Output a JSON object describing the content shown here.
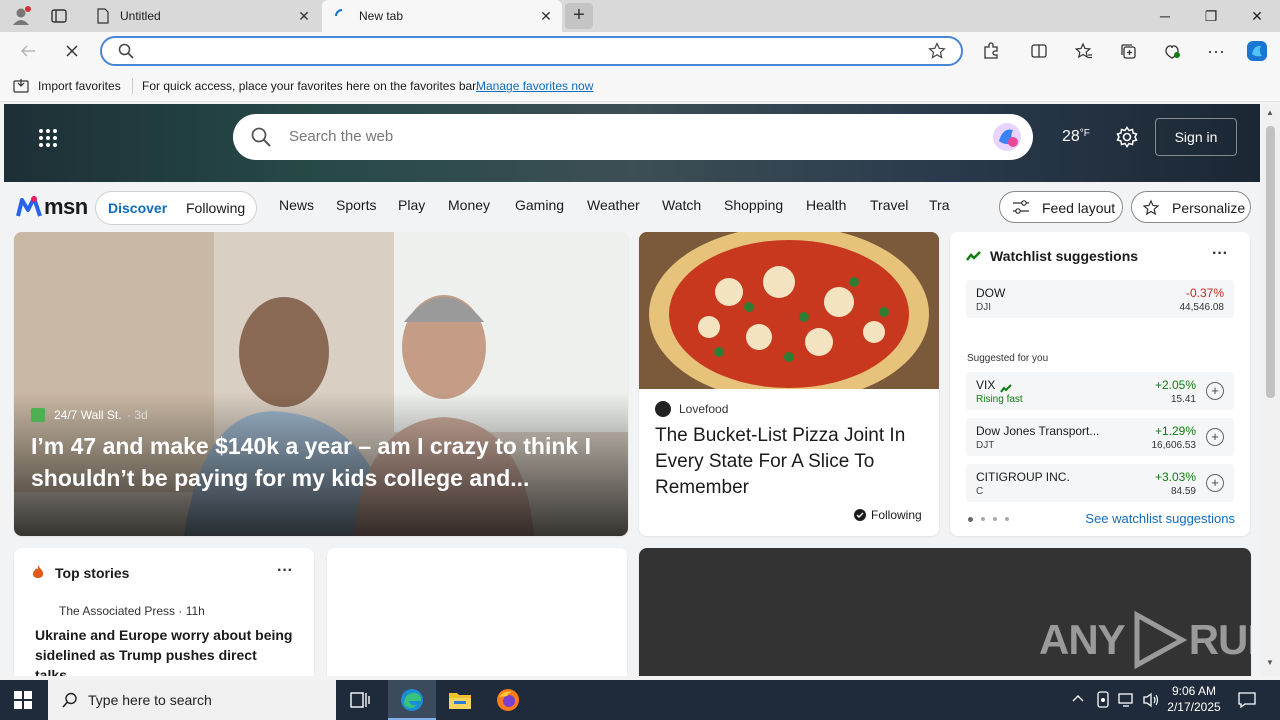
{
  "tabs": [
    {
      "title": "Untitled"
    },
    {
      "title": "New tab"
    }
  ],
  "new_tab_symbol": "+",
  "window_controls": {
    "minimize": "─",
    "restore": "❐",
    "close": "✕"
  },
  "address": {
    "value": ""
  },
  "favbar": {
    "import_label": "Import favorites",
    "message": "For quick access, place your favorites here on the favorites bar.",
    "manage_link": "Manage favorites now"
  },
  "msn": {
    "search_placeholder": "Search the web",
    "temperature": "28",
    "temp_unit": "°F",
    "sign_in": "Sign in",
    "logo_text": "msn",
    "segmented": [
      "Discover",
      "Following"
    ],
    "nav": [
      "News",
      "Sports",
      "Play",
      "Money",
      "Gaming",
      "Weather",
      "Watch",
      "Shopping",
      "Health",
      "Travel",
      "Tra"
    ],
    "feed_layout": "Feed layout",
    "personalize": "Personalize"
  },
  "hero_story": {
    "source": "24/7 Wall St.",
    "age": "· 3d",
    "headline": "I’m 47 and make $140k a year – am I crazy to think I shouldn’t be paying for my kids college and..."
  },
  "pizza_story": {
    "source": "Lovefood",
    "headline": "The Bucket-List Pizza Joint In Every State For A Slice To Remember",
    "following": "Following"
  },
  "watchlist": {
    "title": "Watchlist suggestions",
    "more": "···",
    "suggested_label": "Suggested for you",
    "see_link": "See watchlist suggestions",
    "top": {
      "name": "DOW",
      "sub": "DJI",
      "change": "-0.37%",
      "price": "44,546.08"
    },
    "items": [
      {
        "name": "VIX",
        "sub": "Rising fast",
        "change": "+2.05%",
        "price": "15.41"
      },
      {
        "name": "Dow Jones Transport...",
        "sub": "DJT",
        "change": "+1.29%",
        "price": "16,606.53"
      },
      {
        "name": "CITIGROUP INC.",
        "sub": "C",
        "change": "+3.03%",
        "price": "84.59"
      }
    ],
    "colors": {
      "up": "#107c10",
      "down": "#c42b1c"
    }
  },
  "top_stories": {
    "title": "Top stories",
    "more": "···",
    "source": "The Associated Press · 11h",
    "headline": "Ukraine and Europe worry about being sidelined as Trump pushes direct talks..."
  },
  "watermark": {
    "left": "ANY",
    "right": "RUN"
  },
  "taskbar": {
    "search_placeholder": "Type here to search",
    "time": "9:06 AM",
    "date": "2/17/2025"
  }
}
